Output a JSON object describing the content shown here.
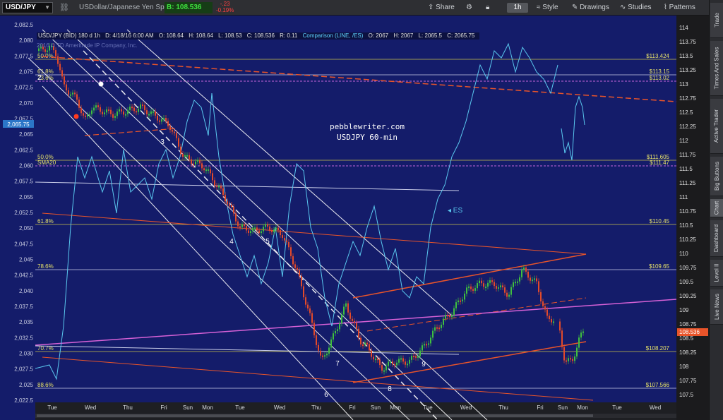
{
  "toolbar": {
    "symbol": "USD/JPY",
    "description": "USDollar/Japanese Yen Spot",
    "bid_label": "B: 108.536",
    "change_line1": "-.23",
    "change_line2": "-0.19%",
    "share_label": "Share",
    "period_label": "1h",
    "style_label": "Style",
    "drawings_label": "Drawings",
    "studies_label": "Studies",
    "patterns_label": "Patterns"
  },
  "info": {
    "title": "USD/JPY (BID) 180 d 1h",
    "date": "D: 4/18/16 6:00 AM",
    "open": "O: 108.64",
    "high": "H: 108.64",
    "low": "L: 108.53",
    "close": "C: 108.536",
    "range": "R: 0.11",
    "comparison": "Comparison (LINE, /ES)",
    "cmp_open": "O: 2067",
    "cmp_high": "H: 2067",
    "cmp_low": "L: 2065.5",
    "cmp_close": "C: 2065.75",
    "copyright": "2016 © TD Ameritrade IP Company, Inc."
  },
  "watermark": {
    "site": "pebblewriter.com",
    "subtitle": "USDJPY 60-min"
  },
  "es_label": "ES",
  "left_axis": {
    "ticks": [
      "2,082.5",
      "2,080",
      "2,077.5",
      "2,075",
      "2,072.5",
      "2,070",
      "2,067.5",
      "2,065",
      "2,062.5",
      "2,060",
      "2,057.5",
      "2,055",
      "2,052.5",
      "2,050",
      "2,047.5",
      "2,045",
      "2,042.5",
      "2,040",
      "2,037.5",
      "2,035",
      "2,032.5",
      "2,030",
      "2,027.5",
      "2,025",
      "2,022.5"
    ],
    "current": "2,065.75"
  },
  "right_axis": {
    "ticks": [
      "114",
      "113.75",
      "113.5",
      "113.25",
      "113",
      "112.75",
      "112.5",
      "112.25",
      "112",
      "111.75",
      "111.5",
      "111.25",
      "111",
      "110.75",
      "110.5",
      "110.25",
      "110",
      "109.75",
      "109.5",
      "109.25",
      "109",
      "108.75",
      "108.5",
      "108.25",
      "108",
      "107.75",
      "107.5"
    ],
    "current": "108.536"
  },
  "x_axis": [
    "Tue",
    "Wed",
    "Thu",
    "Fri",
    "Sun",
    "Mon",
    "Tue",
    "Wed",
    "Thu",
    "Fri",
    "Sun",
    "Mon",
    "Tue",
    "Wed",
    "Thu",
    "Fri",
    "Sun",
    "Mon",
    "Tue",
    "Wed"
  ],
  "fib_levels": [
    {
      "pct": "50.0%",
      "price": "$113.424"
    },
    {
      "pct": "61.8%",
      "price": "$113.15"
    },
    {
      "pct": "23.6%",
      "price": "$113.02"
    },
    {
      "pct": "50.0%",
      "price": "$111.605"
    },
    {
      "pct": "SMA20",
      "price": "$111.47"
    },
    {
      "pct": "61.8%",
      "price": "$110.45"
    },
    {
      "pct": "78.6%",
      "price": "$109.65"
    },
    {
      "pct": "70.7%",
      "price": "$108.207"
    },
    {
      "pct": "88.6%",
      "price": "$107.566"
    }
  ],
  "wave_labels": [
    "2",
    "3",
    "4",
    "5",
    "6",
    "7",
    "8",
    "9"
  ],
  "sidebar_tabs": [
    "Trade",
    "Times And Sales",
    "Active Trader",
    "Big Buttons",
    "Chart",
    "Dashboard",
    "Level II",
    "Live News"
  ],
  "colors": {
    "chart_bg": "#141c6a",
    "up_bar": "#3fbf3f",
    "down_bar": "#e24a2a",
    "comparison": "#5ac8ef",
    "fib_line": "#c9c24a",
    "channel_white": "#ffffff",
    "trend_orange": "#e8542a",
    "magenta": "#d661d6"
  }
}
